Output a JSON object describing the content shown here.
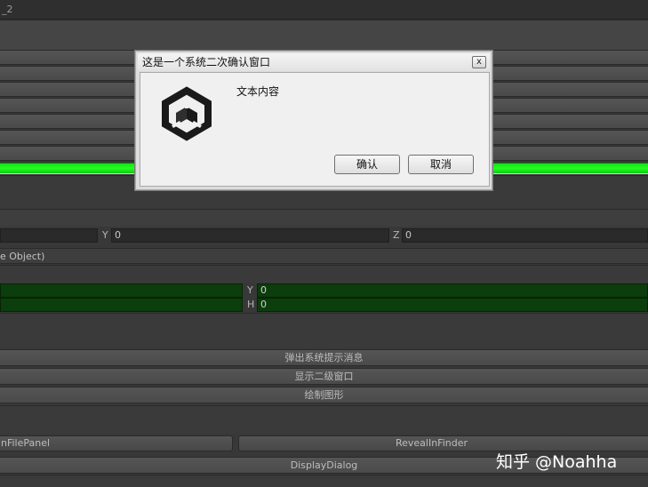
{
  "window": {
    "title_fragment": "_2"
  },
  "transform": {
    "y_label": "Y",
    "y_value": "0",
    "z_label": "Z",
    "z_value": "0",
    "object_field_text": "e Object)"
  },
  "rect": {
    "y_label": "Y",
    "y_value": "0",
    "h_label": "H",
    "h_value": "0"
  },
  "buttons": {
    "show_message": "弹出系统提示消息",
    "show_dialog2": "显示二级窗口",
    "draw_shape": "绘制图形",
    "open_file_panel": "nFilePanel",
    "reveal_in_finder": "RevealInFinder",
    "display_dialog": "DisplayDialog"
  },
  "dialog": {
    "title": "这是一个系统二次确认窗口",
    "close_glyph": "x",
    "message": "文本内容",
    "ok_label": "确认",
    "cancel_label": "取消",
    "icon": "unity-logo-icon"
  },
  "watermark": "知乎 @Noahha",
  "colors": {
    "accent_green": "#22ff22",
    "dark_green": "#0c3d0c"
  }
}
